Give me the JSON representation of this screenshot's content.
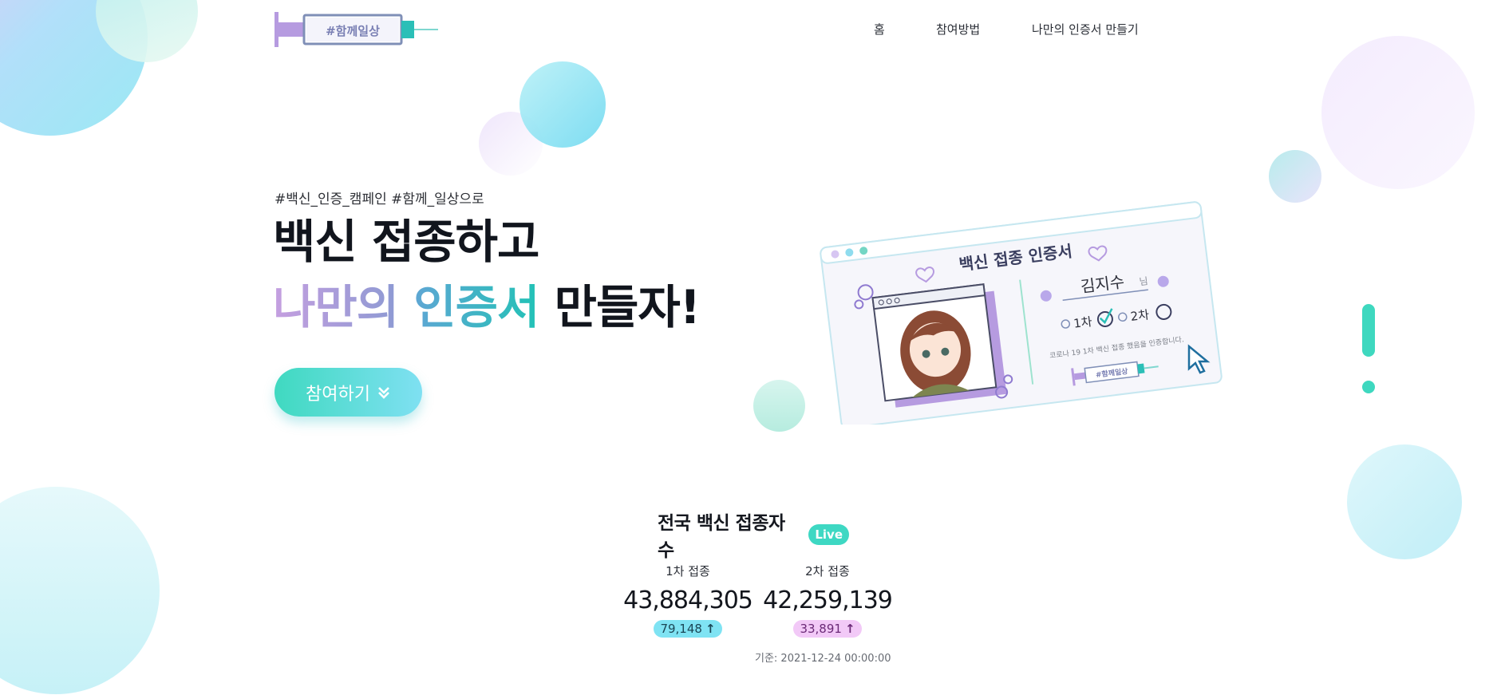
{
  "header": {
    "logo_text": "#함께일상",
    "nav": [
      "홈",
      "참여방법",
      "나만의 인증서 만들기"
    ]
  },
  "hero": {
    "hashtags": "#백신_인증_캠페인 #함께_일상으로",
    "title_line1": "백신 접종하고",
    "title_line2_part1": "나만의",
    "title_line2_part2": "인증서",
    "title_line2_part3": "만들자!",
    "cta_label": "참여하기"
  },
  "certificate": {
    "title": "백신 접종 인증서",
    "name": "김지수",
    "honorific": "님",
    "dose1": "1차",
    "dose2": "2차",
    "description": "코로나 19 1차 백신 접종 했음을 인증합니다.",
    "logo_text": "#함께일상"
  },
  "stats": {
    "title": "전국 백신 접종자 수",
    "live_badge": "Live",
    "first": {
      "label": "1차 접종",
      "value": "43,884,305",
      "delta": "79,148"
    },
    "second": {
      "label": "2차 접종",
      "value": "42,259,139",
      "delta": "33,891"
    },
    "base_time": "기준: 2021-12-24 00:00:00"
  },
  "colors": {
    "accent": "#3ed8c3",
    "purple": "#b69be0",
    "teal": "#2bbfb7"
  }
}
